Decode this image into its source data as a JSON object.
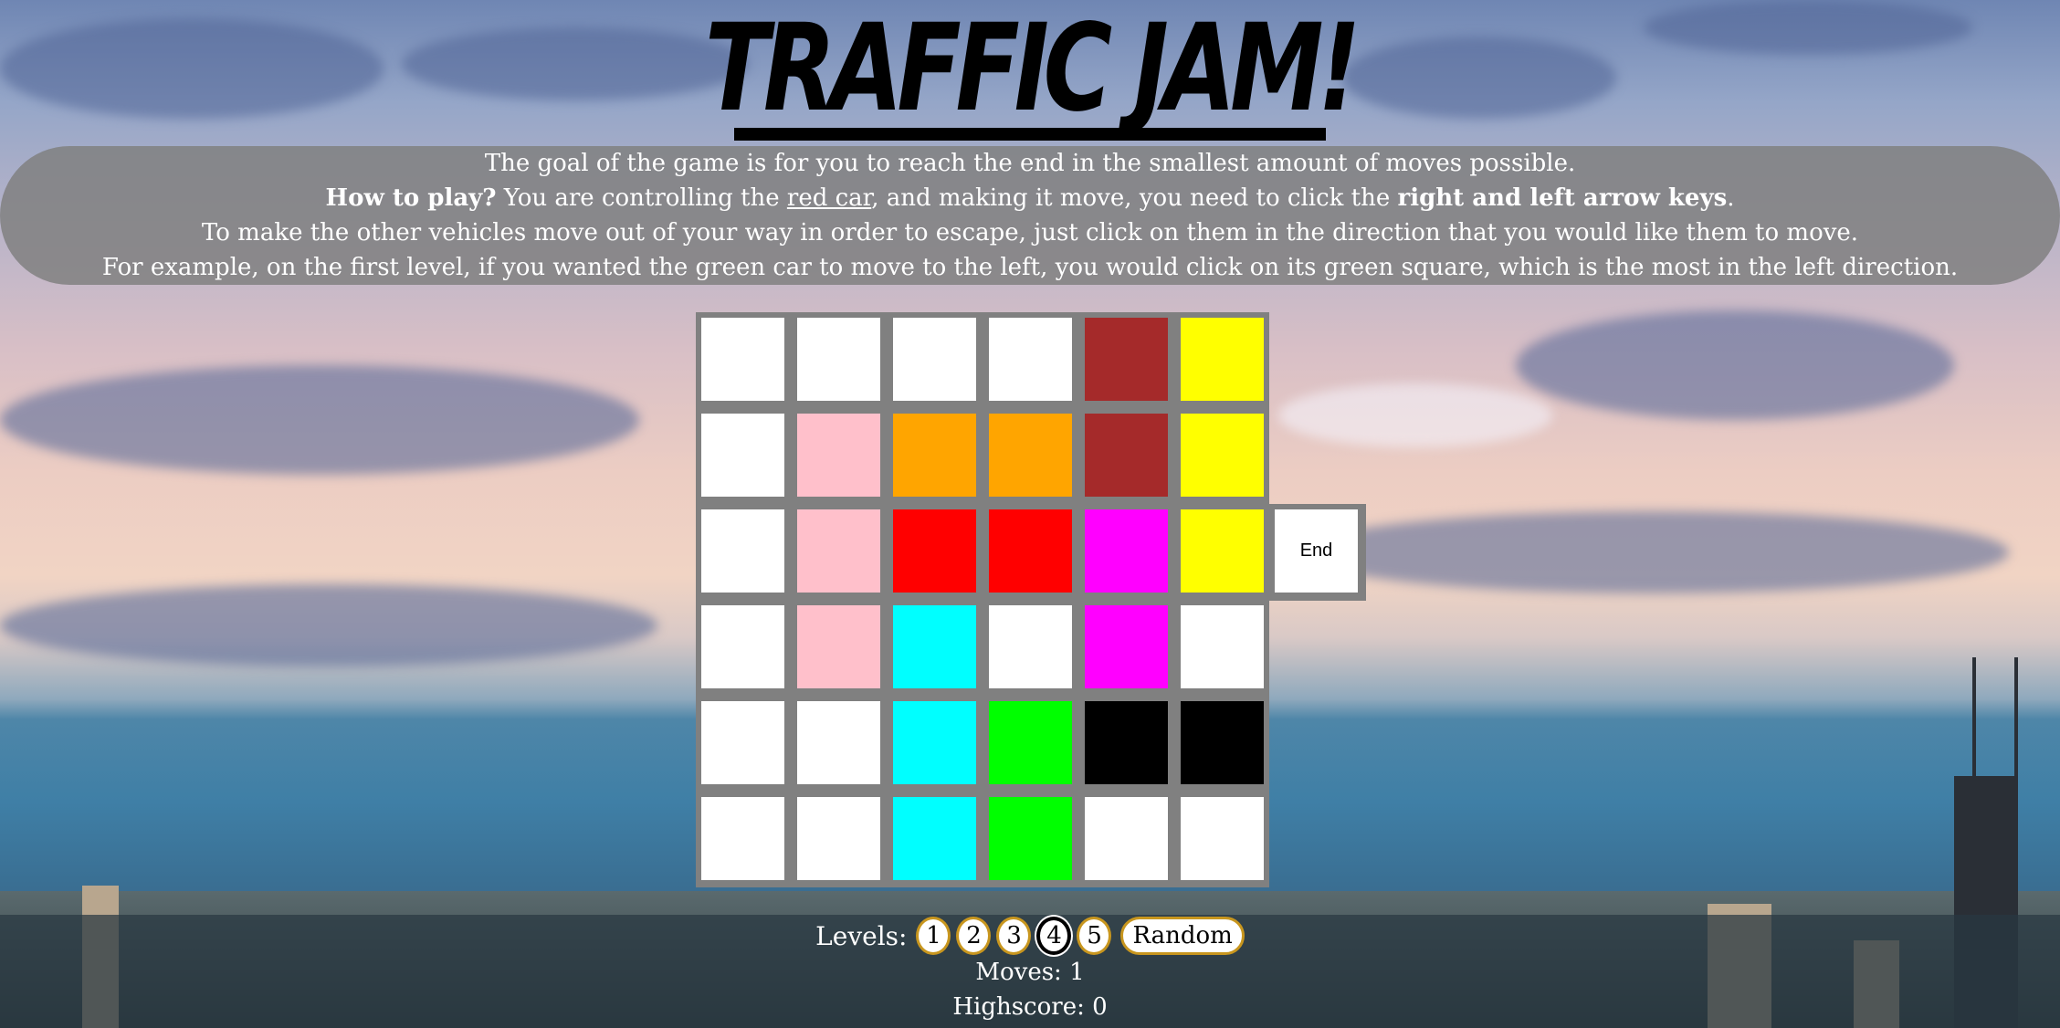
{
  "title": "TRAFFIC JAM!",
  "instructions": {
    "line1": "The goal of the game is for you to reach the end in the smallest amount of moves possible.",
    "line2_bold": "How to play?",
    "line2_a": " You are controlling the ",
    "line2_link": "red car",
    "line2_b": ", and making it move, you need to click the ",
    "line2_bold2": "right and left arrow keys",
    "line2_c": ".",
    "line3": "To make the other vehicles move out of your way in order to escape, just click on them in the direction that you would like them to move.",
    "line4": "For example, on the first level, if you wanted the green car to move to the left, you would click on its green square, which is the most in the left direction."
  },
  "colors": {
    "empty": "#ffffff",
    "brown": "#a52a2a",
    "yellow": "#ffff00",
    "pink": "#ffc0cb",
    "orange": "#ffa500",
    "red": "#ff0000",
    "magenta": "#ff00ff",
    "cyan": "#00ffff",
    "green": "#00ff00",
    "black": "#000000"
  },
  "board": [
    [
      "empty",
      "empty",
      "empty",
      "empty",
      "brown",
      "yellow"
    ],
    [
      "empty",
      "pink",
      "orange",
      "orange",
      "brown",
      "yellow"
    ],
    [
      "empty",
      "pink",
      "red",
      "red",
      "magenta",
      "yellow"
    ],
    [
      "empty",
      "pink",
      "cyan",
      "empty",
      "magenta",
      "empty"
    ],
    [
      "empty",
      "empty",
      "cyan",
      "green",
      "black",
      "black"
    ],
    [
      "empty",
      "empty",
      "cyan",
      "green",
      "empty",
      "empty"
    ]
  ],
  "end_label": "End",
  "levels": {
    "label": "Levels:",
    "buttons": [
      "1",
      "2",
      "3",
      "4",
      "5"
    ],
    "active": "4",
    "random_label": "Random"
  },
  "moves_text": "Moves: 1",
  "highscore_text": "Highscore: 0"
}
